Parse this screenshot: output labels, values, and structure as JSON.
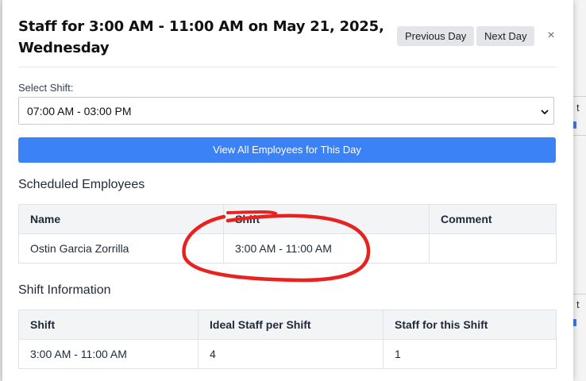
{
  "modal": {
    "title_line1": "Staff for 3:00 AM - 11:00 AM on May 21, 2025,",
    "title_line2": "Wednesday",
    "prev_day_label": "Previous Day",
    "next_day_label": "Next Day",
    "close_glyph": "×"
  },
  "shift_select": {
    "label": "Select Shift:",
    "value": "07:00 AM - 03:00 PM"
  },
  "view_all_button": "View All Employees for This Day",
  "scheduled": {
    "heading": "Scheduled Employees",
    "headers": [
      "Name",
      "Shift",
      "Comment"
    ],
    "rows": [
      [
        "Ostin Garcia Zorrilla",
        "3:00 AM - 11:00 AM",
        ""
      ]
    ]
  },
  "shift_info": {
    "heading": "Shift Information",
    "headers": [
      "Shift",
      "Ideal Staff per Shift",
      "Staff for this Shift"
    ],
    "rows": [
      [
        "3:00 AM - 11:00 AM",
        "4",
        "1"
      ]
    ]
  },
  "annotation": {
    "color": "#e8221e",
    "shape": "hand-drawn circle around shift cell"
  },
  "background_fragments": {
    "text1": "t",
    "text2": "t"
  }
}
